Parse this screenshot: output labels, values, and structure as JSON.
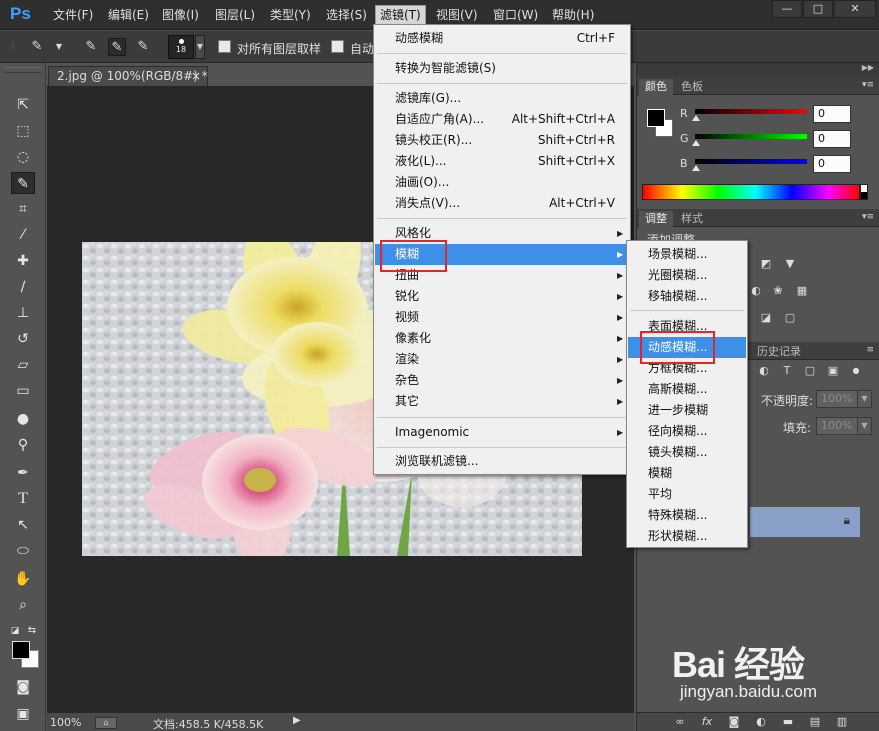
{
  "app": {
    "logo": "Ps",
    "menu": [
      "文件(F)",
      "编辑(E)",
      "图像(I)",
      "图层(L)",
      "类型(Y)",
      "选择(S)",
      "滤镜(T)",
      "视图(V)",
      "窗口(W)",
      "帮助(H)"
    ],
    "active_menu_index": 6,
    "window_buttons": [
      "—",
      "□",
      "✕"
    ]
  },
  "options": {
    "brush_size": "18",
    "sample_all_layers": "对所有图层取样",
    "auto_label": "自动"
  },
  "document": {
    "tab_title": "2.jpg @ 100%(RGB/8#) *",
    "tab_close": "×",
    "zoom": "100%",
    "doc_size": "文档:458.5 K/458.5K"
  },
  "filter_menu": {
    "items": [
      {
        "label": "动感模糊",
        "shortcut": "Ctrl+F"
      },
      {
        "label": "转换为智能滤镜(S)",
        "shortcut": ""
      },
      {
        "label": "滤镜库(G)...",
        "shortcut": ""
      },
      {
        "label": "自适应广角(A)...",
        "shortcut": "Alt+Shift+Ctrl+A"
      },
      {
        "label": "镜头校正(R)...",
        "shortcut": "Shift+Ctrl+R"
      },
      {
        "label": "液化(L)...",
        "shortcut": "Shift+Ctrl+X"
      },
      {
        "label": "油画(O)...",
        "shortcut": ""
      },
      {
        "label": "消失点(V)...",
        "shortcut": "Alt+Ctrl+V"
      },
      {
        "label": "风格化",
        "shortcut": ""
      },
      {
        "label": "模糊",
        "shortcut": ""
      },
      {
        "label": "扭曲",
        "shortcut": ""
      },
      {
        "label": "锐化",
        "shortcut": ""
      },
      {
        "label": "视频",
        "shortcut": ""
      },
      {
        "label": "像素化",
        "shortcut": ""
      },
      {
        "label": "渲染",
        "shortcut": ""
      },
      {
        "label": "杂色",
        "shortcut": ""
      },
      {
        "label": "其它",
        "shortcut": ""
      },
      {
        "label": "Imagenomic",
        "shortcut": ""
      },
      {
        "label": "浏览联机滤镜...",
        "shortcut": ""
      }
    ]
  },
  "blur_submenu": {
    "items": [
      "场景模糊...",
      "光圈模糊...",
      "移轴模糊...",
      "表面模糊...",
      "动感模糊...",
      "方框模糊...",
      "高斯模糊...",
      "进一步模糊",
      "径向模糊...",
      "镜头模糊...",
      "模糊",
      "平均",
      "特殊模糊...",
      "形状模糊..."
    ],
    "highlighted_index": 4
  },
  "panels": {
    "color_tabs": [
      "颜色",
      "色板"
    ],
    "rgb_labels": [
      "R",
      "G",
      "B"
    ],
    "rgb_values": [
      "0",
      "0",
      "0"
    ],
    "adjust_tabs": [
      "调整",
      "样式"
    ],
    "adjust_title": "添加调整",
    "history_tab": "历史记录",
    "opacity_label": "不透明度:",
    "opacity_value": "100%",
    "fill_label": "填充:",
    "fill_value": "100%"
  },
  "watermark": {
    "text": "Bai 经验",
    "url": "jingyan.baidu.com"
  },
  "colors": {
    "accent_highlight": "#3d8fe8",
    "callout_red": "#e3262b",
    "ps_blue": "#3aa3ff"
  }
}
